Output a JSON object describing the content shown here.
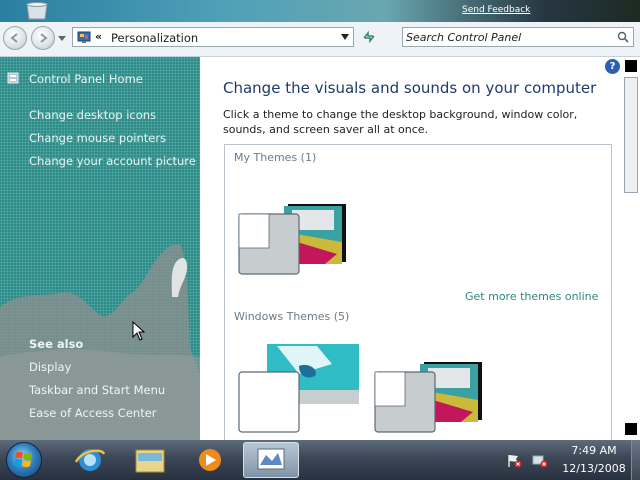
{
  "desktop": {
    "feedback_link": "Send Feedback"
  },
  "address_bar": {
    "chevron": "«",
    "location": "Personalization",
    "search_placeholder": "Search Control Panel"
  },
  "left_pane": {
    "home": "Control Panel Home",
    "links": [
      "Change desktop icons",
      "Change mouse pointers",
      "Change your account picture"
    ],
    "see_also": {
      "title": "See also",
      "links": [
        "Display",
        "Taskbar and Start Menu",
        "Ease of Access Center"
      ]
    }
  },
  "content": {
    "help_label": "?",
    "heading": "Change the visuals and sounds on your computer",
    "description": "Click a theme to change the desktop background, window color, sounds, and screen saver all at once.",
    "my_themes_title": "My Themes (1)",
    "get_more_link": "Get more themes online",
    "windows_themes_title": "Windows Themes (5)"
  },
  "taskbar": {
    "clock_time": "7:49 AM",
    "clock_date": "12/13/2008",
    "pinned": [
      "internet-explorer",
      "windows-explorer",
      "media-player",
      "personalization-window"
    ]
  },
  "colors": {
    "left_pane_bg": "#2e8a86",
    "heading": "#1e3a6e",
    "link_teal": "#2a8a7a",
    "taskbar_top": "#5d6b7a"
  }
}
